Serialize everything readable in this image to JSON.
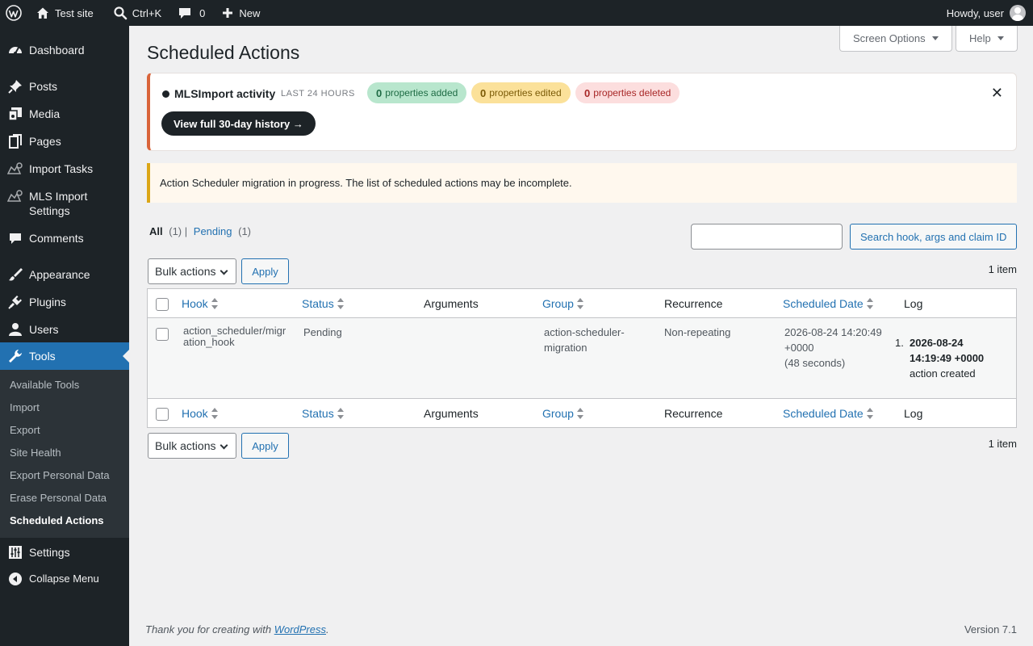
{
  "adminbar": {
    "site_name": "Test site",
    "search_shortcut": "Ctrl+K",
    "comments_count": "0",
    "new_label": "New",
    "howdy": "Howdy, user"
  },
  "sidebar": {
    "items": [
      {
        "label": "Dashboard",
        "icon": "dashboard-icon"
      },
      {
        "label": "Posts",
        "icon": "pushpin-icon"
      },
      {
        "label": "Media",
        "icon": "media-icon"
      },
      {
        "label": "Pages",
        "icon": "pages-icon"
      },
      {
        "label": "Import Tasks",
        "icon": "import-tasks-icon"
      },
      {
        "label": "MLS Import Settings",
        "icon": "mls-settings-icon"
      },
      {
        "label": "Comments",
        "icon": "comment-icon"
      },
      {
        "label": "Appearance",
        "icon": "paintbrush-icon"
      },
      {
        "label": "Plugins",
        "icon": "plugin-icon"
      },
      {
        "label": "Users",
        "icon": "user-icon"
      },
      {
        "label": "Tools",
        "icon": "wrench-icon"
      },
      {
        "label": "Settings",
        "icon": "settings-sliders-icon"
      },
      {
        "label": "Collapse Menu",
        "icon": "collapse-icon"
      }
    ],
    "tools_submenu": [
      "Available Tools",
      "Import",
      "Export",
      "Site Health",
      "Export Personal Data",
      "Erase Personal Data",
      "Scheduled Actions"
    ]
  },
  "header": {
    "screen_options": "Screen Options",
    "help": "Help",
    "page_title": "Scheduled Actions"
  },
  "mls_activity": {
    "title": "MLSImport activity",
    "range": "LAST 24 HOURS",
    "added_count": "0",
    "added_label": "properties added",
    "edited_count": "0",
    "edited_label": "properties edited",
    "deleted_count": "0",
    "deleted_label": "properties deleted",
    "history_button": "View full 30-day history →",
    "close": "✕"
  },
  "notice": "Action Scheduler migration in progress. The list of scheduled actions may be incomplete.",
  "filters": {
    "all_label": "All",
    "all_count": "(1)",
    "sep": "|",
    "pending_label": "Pending",
    "pending_count": "(1)"
  },
  "search": {
    "placeholder": "",
    "button": "Search hook, args and claim ID"
  },
  "bulk": {
    "selected": "Bulk actions",
    "apply": "Apply",
    "items_count": "1 item"
  },
  "table": {
    "columns": [
      "Hook",
      "Status",
      "Arguments",
      "Group",
      "Recurrence",
      "Scheduled Date",
      "Log"
    ],
    "row": {
      "hook_line1": "action_scheduler/migr",
      "hook_line2": "ation_hook",
      "status": "Pending",
      "arguments": "",
      "group_line1": "action-scheduler-",
      "group_line2": "migration",
      "recurrence": "Non-repeating",
      "date_line1": "2026-08-24 14:20:49",
      "date_line2": "+0000",
      "date_line3": "(48 seconds)",
      "log_num": "1.",
      "log_line1": "2026-08-24",
      "log_line2": "14:19:49 +0000",
      "log_line3": "action created"
    }
  },
  "footer": {
    "thanks_prefix": "Thank you for creating with ",
    "thanks_link": "WordPress",
    "thanks_suffix": ".",
    "version": "Version 7.1"
  },
  "colors": {
    "admin_dark": "#1d2327",
    "accent_blue": "#2271b1",
    "mls_border": "#d9643a",
    "notice_border": "#dba617"
  }
}
